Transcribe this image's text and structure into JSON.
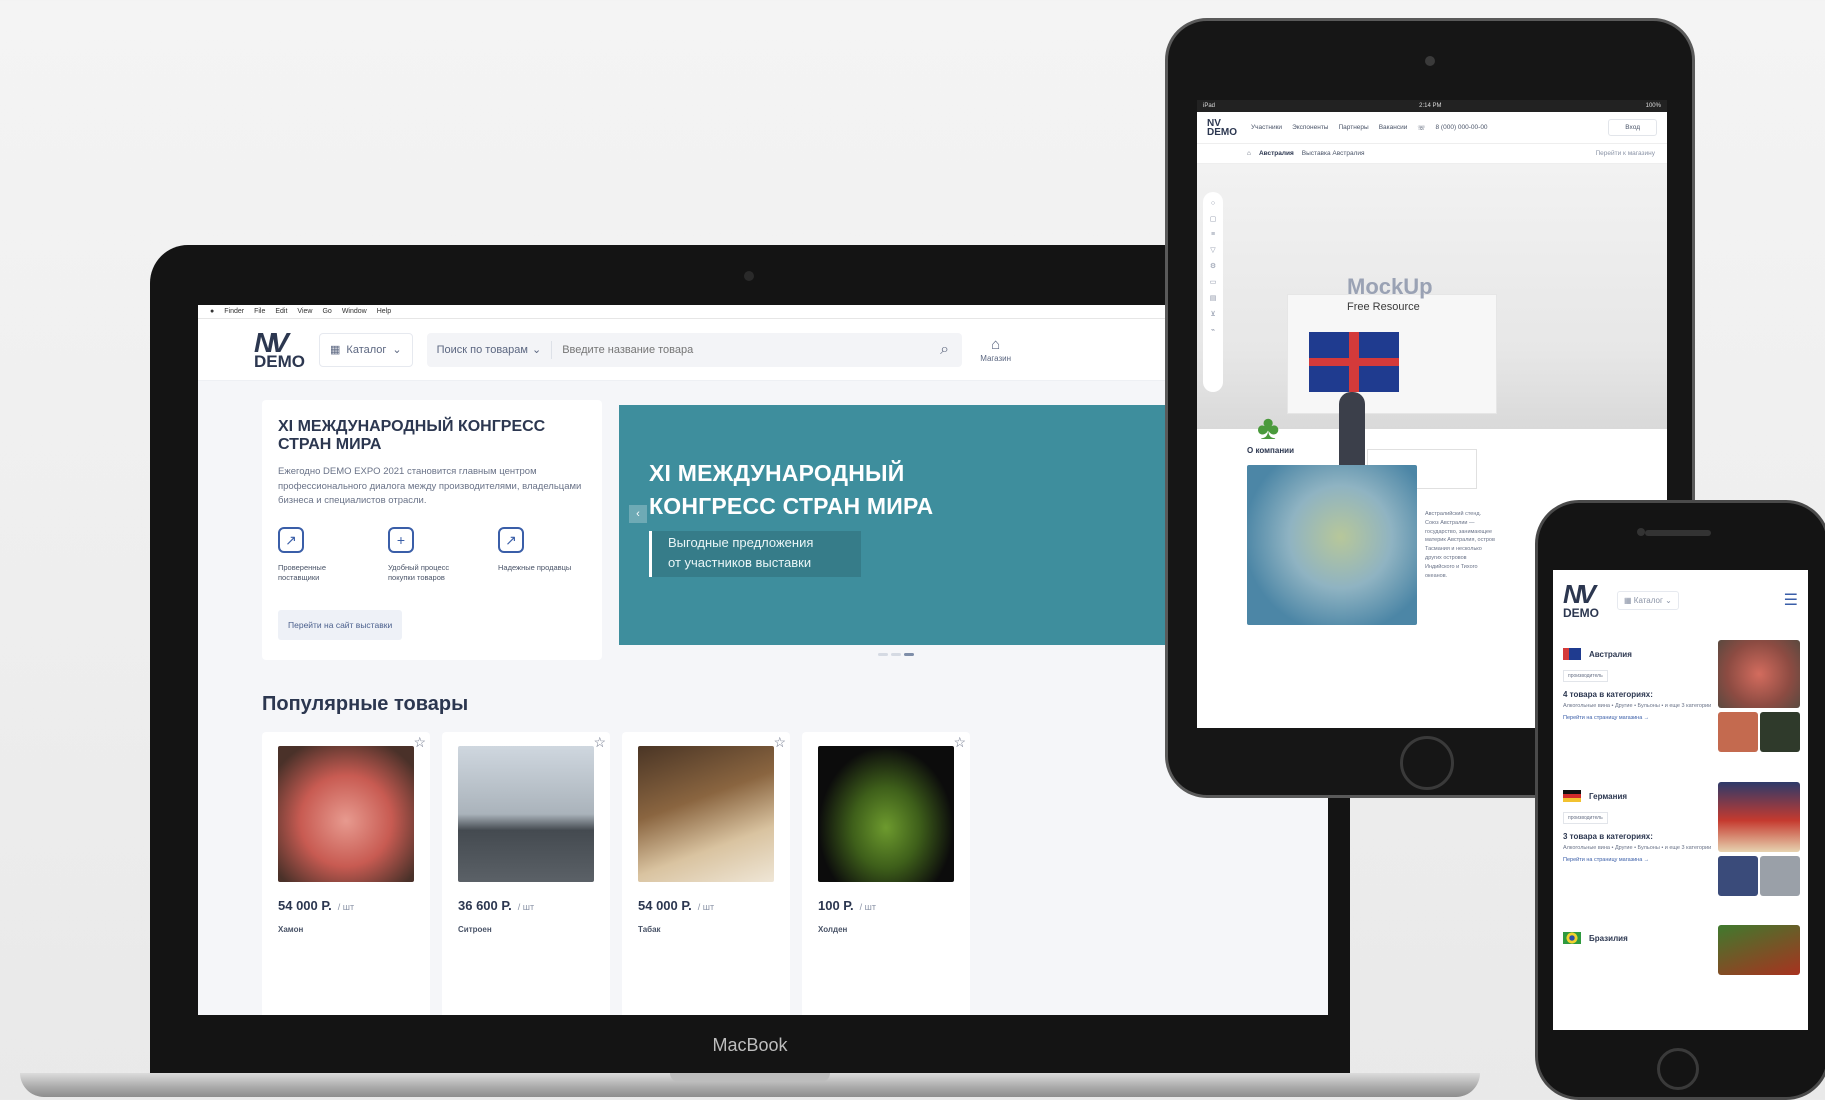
{
  "laptop": {
    "brand": "MacBook",
    "menubar": [
      "Finder",
      "File",
      "Edit",
      "View",
      "Go",
      "Window",
      "Help"
    ],
    "header": {
      "logo_mark": "NV",
      "logo_word": "DEMO",
      "catalog": "Каталог",
      "search_scope": "Поиск по товарам",
      "search_placeholder": "Введите название товара",
      "shop_label": "Магазин"
    },
    "promo": {
      "title": "XI МЕЖДУНАРОДНЫЙ КОНГРЕСС СТРАН МИРА",
      "text": "Ежегодно DEMO EXPO 2021 становится главным центром профессионального диалога между производителями, владельцами бизнеса и специалистов отрасли.",
      "features": [
        {
          "icon": "chart-icon",
          "label": "Проверенные поставщики"
        },
        {
          "icon": "cart-plus-icon",
          "label": "Удобный процесс покупки товаров"
        },
        {
          "icon": "chart-icon",
          "label": "Надежные продавцы"
        }
      ],
      "button": "Перейти на сайт выставки"
    },
    "banner": {
      "title_line1": "XI МЕЖДУНАРОДНЫЙ",
      "title_line2": "КОНГРЕСС СТРАН МИРА",
      "sub_line1": "Выгодные предложения",
      "sub_line2": "от участников выставки",
      "color": "#3e8e9d"
    },
    "section_title": "Популярные товары",
    "products": [
      {
        "price": "54 000 Р.",
        "unit": "/ шт",
        "name": "Хамон"
      },
      {
        "price": "36 600 Р.",
        "unit": "/ шт",
        "name": "Ситроен"
      },
      {
        "price": "54 000 Р.",
        "unit": "/ шт",
        "name": "Табак"
      },
      {
        "price": "100 Р.",
        "unit": "/ шт",
        "name": "Холден"
      }
    ]
  },
  "tablet": {
    "status_left": "iPad",
    "status_time": "2:14 PM",
    "status_right": "100%",
    "nav": [
      "Участники",
      "Экспоненты",
      "Партнеры",
      "Вакансии"
    ],
    "phone": "8 (000) 000-00-00",
    "login": "Вход",
    "crumb_country": "Австралия",
    "crumb_booth": "Выставка Австралия",
    "crumb_link": "Перейти к магазину",
    "stand_text": "MockUp",
    "stand_sub": "Free Resource",
    "about": "О компании",
    "desc": "Австралийский стенд. Союз Австралии — государство, занимающее материк Австралия, остров Тасмания и несколько других островов Индийского и Тихого океанов."
  },
  "phone": {
    "catalog": "Каталог",
    "countries": [
      {
        "name": "Австралия",
        "tag": "производитель",
        "count": "4 товара в категориях:",
        "cats": "Алкогольные вина • Другие • Бульоны • и еще 3 категории",
        "link": "Перейти на страницу магазина →"
      },
      {
        "name": "Германия",
        "tag": "производитель",
        "count": "3 товара в категориях:",
        "cats": "Алкогольные вина • Другие • Бульоны • и еще 3 категории",
        "link": "Перейти на страницу магазина →"
      },
      {
        "name": "Бразилия"
      }
    ]
  }
}
